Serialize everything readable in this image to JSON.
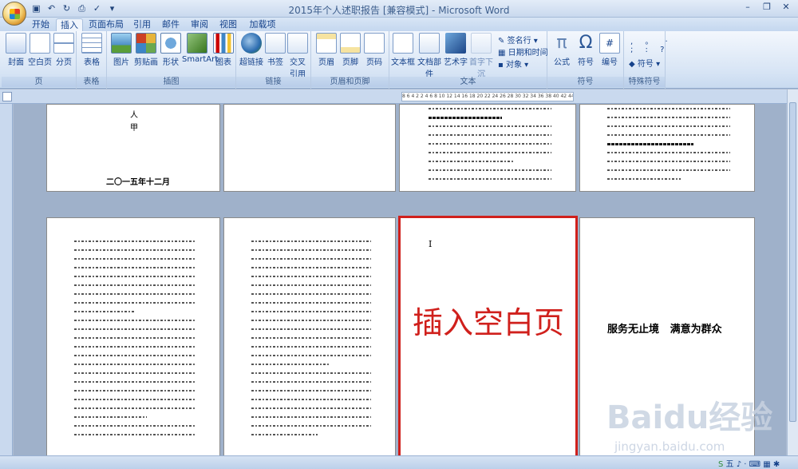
{
  "window": {
    "title": "2015年个人述职报告 [兼容模式] - Microsoft Word",
    "qat": [
      "save-icon",
      "undo-icon",
      "redo-icon",
      "print-preview-icon",
      "spelling-icon",
      "customize-icon"
    ]
  },
  "tabs": [
    "开始",
    "插入",
    "页面布局",
    "引用",
    "邮件",
    "审阅",
    "视图",
    "加载项"
  ],
  "ribbon": {
    "page_group": {
      "label": "页",
      "buttons": [
        "封面",
        "空白页",
        "分页"
      ]
    },
    "table_group": {
      "label": "表格",
      "buttons": [
        "表格"
      ]
    },
    "illustration_group": {
      "label": "插图",
      "buttons": [
        "图片",
        "剪贴画",
        "形状",
        "SmartArt",
        "图表"
      ]
    },
    "links_group": {
      "label": "链接",
      "buttons": [
        "超链接",
        "书签",
        "交叉引用"
      ]
    },
    "header_footer_group": {
      "label": "页眉和页脚",
      "buttons": [
        "页眉",
        "页脚",
        "页码"
      ]
    },
    "text_group": {
      "label": "文本",
      "buttons": [
        "文本框",
        "文档部件",
        "艺术字",
        "首字下沉"
      ],
      "small": [
        "签名行",
        "日期和时间",
        "对象"
      ]
    },
    "symbol_group": {
      "label": "符号",
      "buttons": [
        "公式",
        "符号",
        "编号"
      ]
    },
    "special_group": {
      "label": "特殊符号",
      "small": [
        "符号"
      ]
    }
  },
  "ruler": {
    "numbers": "8 6 4 2  2 4 6 8 10 12 14 16 18 20 22 24 26 28 30 32 34 36 38 40 42 44 46"
  },
  "pages": {
    "cover": {
      "lines": [
        "人",
        "甲"
      ],
      "date": "二〇一五年十二月"
    },
    "blank": {
      "caption": "插入空白页",
      "cursor": "I"
    },
    "slogan": "服务无止境   满意为群众"
  },
  "status": {
    "ime": "五"
  },
  "watermark": {
    "logo": "Baidu经验",
    "url": "jingyan.baidu.com"
  },
  "colors": {
    "highlight": "#d0201c",
    "caption": "#d0201c"
  }
}
